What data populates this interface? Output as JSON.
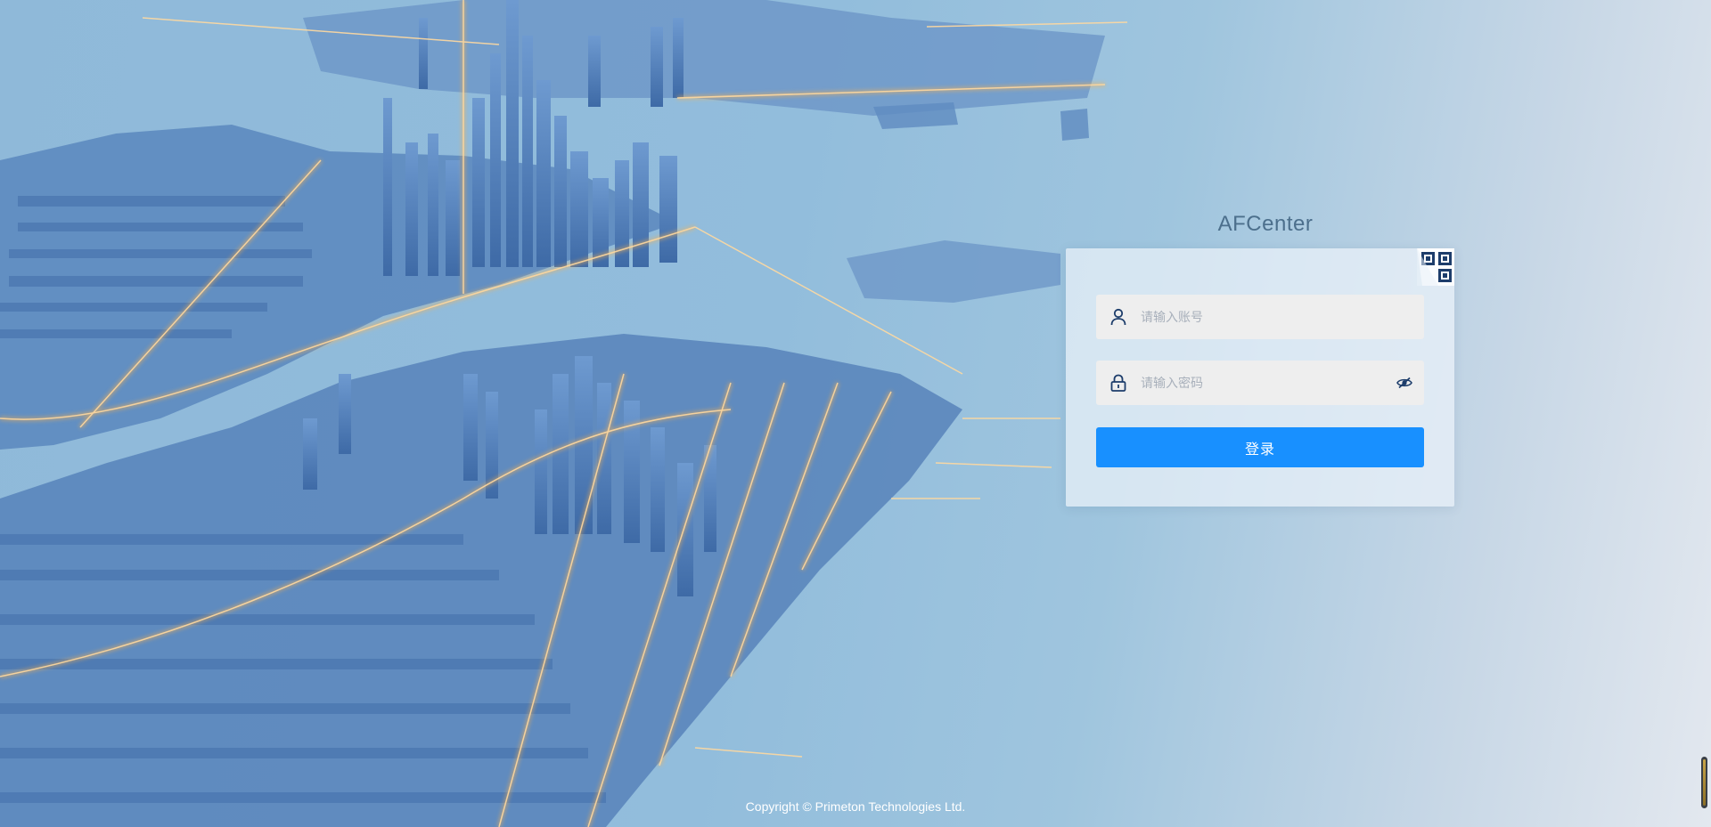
{
  "app": {
    "title": "AFCenter"
  },
  "login": {
    "username_placeholder": "请输入账号",
    "password_placeholder": "请输入密码",
    "username_value": "",
    "password_value": "",
    "submit_label": "登录"
  },
  "footer": {
    "copyright": "Copyright © Primeton Technologies Ltd."
  },
  "icons": {
    "username": "user-icon",
    "password": "lock-icon",
    "toggle_password": "eye-icon",
    "qr_login": "qr-code-icon"
  },
  "colors": {
    "accent": "#1890ff",
    "icon": "#1d3d6b",
    "title": "#4c6f8c",
    "city_glow": "#ffb24a",
    "city_building": "#4f7fb8"
  }
}
